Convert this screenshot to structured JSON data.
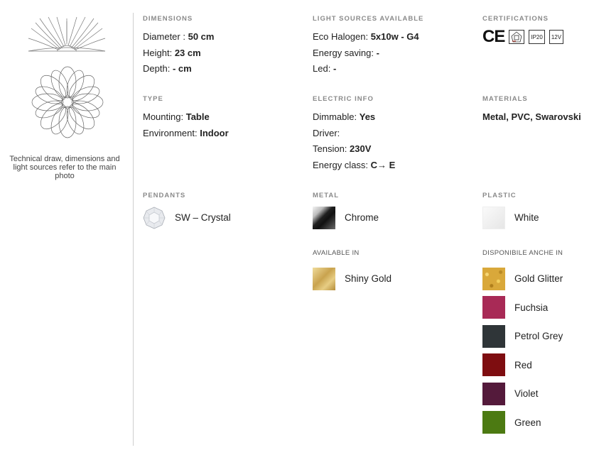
{
  "caption": "Technical draw, dimensions and light sources refer to the main photo",
  "dimensions": {
    "heading": "DIMENSIONS",
    "lines": [
      {
        "label": "Diameter :",
        "value": "50 cm"
      },
      {
        "label": "Height:",
        "value": "23 cm"
      },
      {
        "label": "Depth:",
        "value": "- cm"
      }
    ]
  },
  "light_sources": {
    "heading": "LIGHT SOURCES AVAILABLE",
    "lines": [
      {
        "label": "Eco Halogen:",
        "value": "5x10w - G4"
      },
      {
        "label": "Energy saving:",
        "value": "-"
      },
      {
        "label": "Led:",
        "value": "-"
      }
    ]
  },
  "certifications": {
    "heading": "CERTIFICATIONS",
    "ce": "CE",
    "badges": [
      "IP20",
      "12V"
    ]
  },
  "type": {
    "heading": "TYPE",
    "lines": [
      {
        "label": "Mounting:",
        "value": "Table"
      },
      {
        "label": "Environment:",
        "value": "Indoor"
      }
    ]
  },
  "electric": {
    "heading": "ELECTRIC INFO",
    "lines": [
      {
        "label": "Dimmable:",
        "value": "Yes"
      },
      {
        "label": "Driver:",
        "value": ""
      },
      {
        "label": "Tension:",
        "value": "230V"
      },
      {
        "label": "Energy class:",
        "value": "C→ E"
      }
    ]
  },
  "materials": {
    "heading": "MATERIALS",
    "value": "Metal, PVC, Swarovski"
  },
  "pendants": {
    "heading": "PENDANTS",
    "items": [
      {
        "label": "SW – Crystal",
        "icon": "crystal-icon"
      }
    ]
  },
  "metal": {
    "heading": "METAL",
    "items": [
      {
        "label": "Chrome",
        "color": "#2a2a2a"
      }
    ]
  },
  "plastic": {
    "heading": "PLASTIC",
    "items": [
      {
        "label": "White",
        "color": "#f2f2f2"
      }
    ]
  },
  "available_in": {
    "heading": "AVAILABLE IN",
    "items": [
      {
        "label": "Shiny Gold",
        "color": "#d8b865"
      }
    ]
  },
  "disponibile": {
    "heading": "DISPONIBILE ANCHE IN",
    "items": [
      {
        "label": "Gold Glitter",
        "color": "#d9a83a"
      },
      {
        "label": "Fuchsia",
        "color": "#a82a56"
      },
      {
        "label": "Petrol Grey",
        "color": "#2f3538"
      },
      {
        "label": "Red",
        "color": "#7e0d10"
      },
      {
        "label": "Violet",
        "color": "#541a3b"
      },
      {
        "label": "Green",
        "color": "#4c7a12"
      }
    ]
  }
}
